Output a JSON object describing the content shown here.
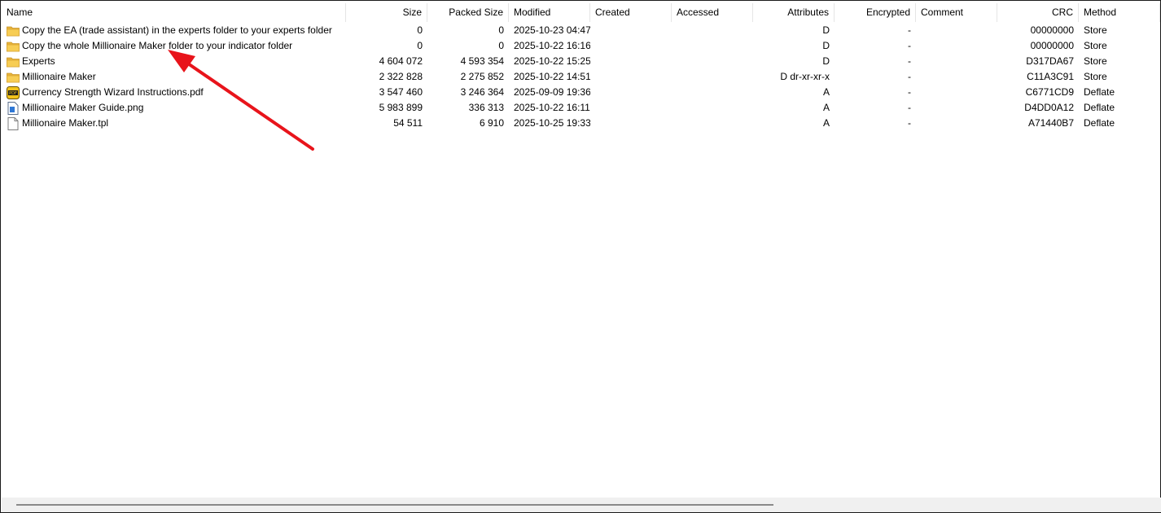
{
  "columns": {
    "name": "Name",
    "size": "Size",
    "packed": "Packed Size",
    "modified": "Modified",
    "created": "Created",
    "accessed": "Accessed",
    "attributes": "Attributes",
    "encrypted": "Encrypted",
    "comment": "Comment",
    "crc": "CRC",
    "method": "Method"
  },
  "rows": [
    {
      "icon": "folder-icon",
      "name": "Copy the EA (trade assistant) in the experts folder to your experts folder",
      "size": "0",
      "packed": "0",
      "modified": "2025-10-23 04:47",
      "created": "",
      "accessed": "",
      "attributes": "D",
      "encrypted": "-",
      "comment": "",
      "crc": "00000000",
      "method": "Store"
    },
    {
      "icon": "folder-icon",
      "name": "Copy the whole Millionaire Maker folder to your indicator folder",
      "size": "0",
      "packed": "0",
      "modified": "2025-10-22 16:16",
      "created": "",
      "accessed": "",
      "attributes": "D",
      "encrypted": "-",
      "comment": "",
      "crc": "00000000",
      "method": "Store"
    },
    {
      "icon": "folder-icon",
      "name": "Experts",
      "size": "4 604 072",
      "packed": "4 593 354",
      "modified": "2025-10-22 15:25",
      "created": "",
      "accessed": "",
      "attributes": "D",
      "encrypted": "-",
      "comment": "",
      "crc": "D317DA67",
      "method": "Store"
    },
    {
      "icon": "folder-icon",
      "name": "Millionaire Maker",
      "size": "2 322 828",
      "packed": "2 275 852",
      "modified": "2025-10-22 14:51",
      "created": "",
      "accessed": "",
      "attributes": "D dr-xr-xr-x",
      "encrypted": "-",
      "comment": "",
      "crc": "C11A3C91",
      "method": "Store"
    },
    {
      "icon": "pdf-icon",
      "name": "Currency Strength Wizard Instructions.pdf",
      "size": "3 547 460",
      "packed": "3 246 364",
      "modified": "2025-09-09 19:36",
      "created": "",
      "accessed": "",
      "attributes": "A",
      "encrypted": "-",
      "comment": "",
      "crc": "C6771CD9",
      "method": "Deflate"
    },
    {
      "icon": "image-file-icon",
      "name": "Millionaire Maker Guide.png",
      "size": "5 983 899",
      "packed": "336 313",
      "modified": "2025-10-22 16:11",
      "created": "",
      "accessed": "",
      "attributes": "A",
      "encrypted": "-",
      "comment": "",
      "crc": "D4DD0A12",
      "method": "Deflate"
    },
    {
      "icon": "blank-file-icon",
      "name": "Millionaire Maker.tpl",
      "size": "54 511",
      "packed": "6 910",
      "modified": "2025-10-25 19:33",
      "created": "",
      "accessed": "",
      "attributes": "A",
      "encrypted": "-",
      "comment": "",
      "crc": "A71440B7",
      "method": "Deflate"
    }
  ],
  "colors": {
    "arrow": "#e8141b",
    "folder": "#f5c542"
  }
}
